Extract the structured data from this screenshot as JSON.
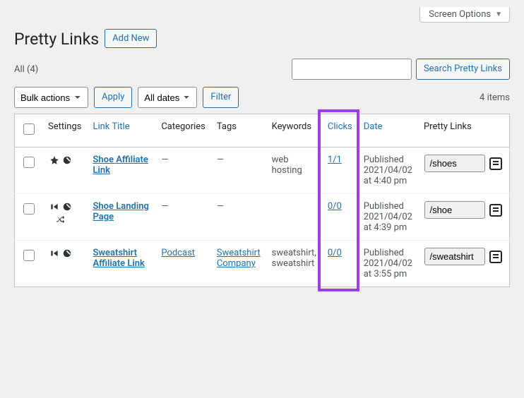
{
  "screen_options_label": "Screen Options",
  "page_title": "Pretty Links",
  "add_new_label": "Add New",
  "filter_all_label": "All",
  "filter_all_count": "(4)",
  "search_button": "Search Pretty Links",
  "bulk_select_label": "Bulk actions",
  "apply_label": "Apply",
  "dates_select_label": "All dates",
  "filter_button": "Filter",
  "items_count": "4 items",
  "columns": {
    "settings": "Settings",
    "title": "Link Title",
    "categories": "Categories",
    "tags": "Tags",
    "keywords": "Keywords",
    "clicks": "Clicks",
    "date": "Date",
    "pretty": "Pretty Links"
  },
  "rows": [
    {
      "title": "Shoe Affiliate Link",
      "categories": "—",
      "tags": "—",
      "keywords": "web hosting",
      "clicks": "1/1",
      "date": "Published 2021/04/02 at 4:40 pm",
      "slug": "/shoes",
      "icons": [
        "star",
        "disable"
      ]
    },
    {
      "title": "Shoe Landing Page",
      "categories": "—",
      "tags": "—",
      "keywords": "",
      "clicks": "0/0",
      "date": "Published 2021/04/02 at 4:39 pm",
      "slug": "/shoe",
      "icons": [
        "forward",
        "disable",
        "shuffle"
      ]
    },
    {
      "title": "Sweatshirt Affiliate Link",
      "categories": "Podcast",
      "tags": "Sweatshirt Company",
      "keywords": "sweatshirt, sweatshirt",
      "clicks": "0/0",
      "date": "Published 2021/04/02 at 3:55 pm",
      "slug": "/sweatshirt",
      "icons": [
        "forward",
        "disable"
      ]
    }
  ]
}
